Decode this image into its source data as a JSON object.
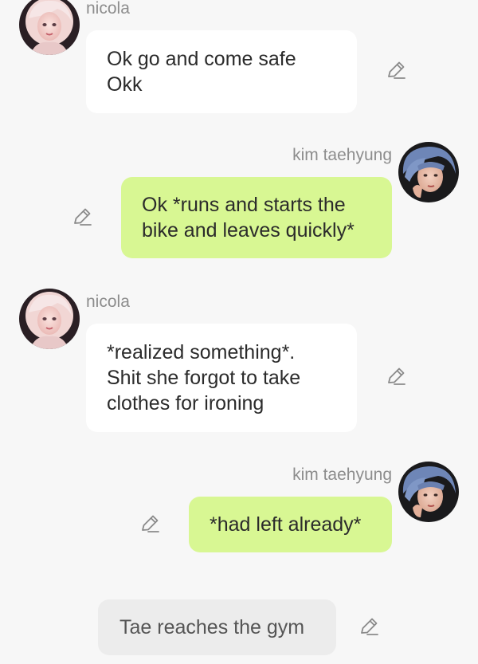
{
  "messages": [
    {
      "type": "incoming",
      "sender": "nicola",
      "avatar_icon": "nicola-avatar",
      "lines": [
        "Ok go and come safe",
        "Okk"
      ]
    },
    {
      "type": "outgoing",
      "sender": "kim taehyung",
      "avatar_icon": "kim-taehyung-avatar",
      "lines": [
        "Ok *runs and starts the",
        "bike and leaves quickly*"
      ]
    },
    {
      "type": "incoming",
      "sender": "nicola",
      "avatar_icon": "nicola-avatar",
      "lines": [
        "*realized something*.",
        "Shit she forgot to take",
        "clothes for ironing"
      ]
    },
    {
      "type": "outgoing",
      "sender": "kim taehyung",
      "avatar_icon": "kim-taehyung-avatar",
      "lines": [
        "*had left already*"
      ]
    },
    {
      "type": "narration",
      "lines": [
        "Tae reaches the gym"
      ]
    }
  ],
  "icons": {
    "edit": "pencil-edit-icon"
  },
  "colors": {
    "background": "#f7f7f7",
    "incoming_bubble": "#ffffff",
    "outgoing_bubble": "#d8f793",
    "narration_bubble": "#ececec",
    "sender_name": "#8d8d8d"
  }
}
